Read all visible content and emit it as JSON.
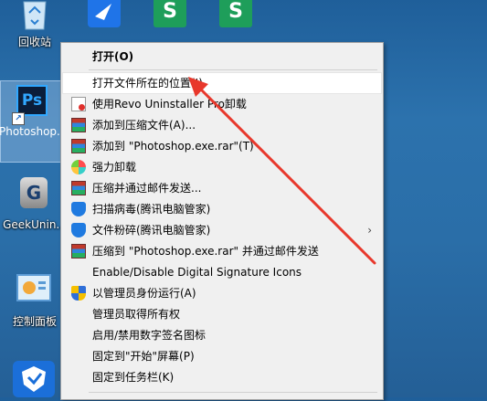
{
  "desktop": {
    "icons": {
      "recycle_bin": "回收站",
      "photoshop": "Photoshop.exe",
      "geek": "GeekUnin...",
      "control_panel": "控制面板"
    },
    "top_app_1": "S",
    "top_app_2": "S"
  },
  "menu": {
    "items": [
      {
        "label": "打开(O)"
      },
      {
        "label": "打开文件所在的位置(I)"
      },
      {
        "label": "使用Revo Uninstaller Pro卸载"
      },
      {
        "label": "添加到压缩文件(A)..."
      },
      {
        "label": "添加到 \"Photoshop.exe.rar\"(T)"
      },
      {
        "label": "强力卸载"
      },
      {
        "label": "压缩并通过邮件发送..."
      },
      {
        "label": "扫描病毒(腾讯电脑管家)"
      },
      {
        "label": "文件粉碎(腾讯电脑管家)"
      },
      {
        "label": "压缩到 \"Photoshop.exe.rar\" 并通过邮件发送"
      },
      {
        "label": "Enable/Disable Digital Signature Icons"
      },
      {
        "label": "以管理员身份运行(A)"
      },
      {
        "label": "管理员取得所有权"
      },
      {
        "label": "启用/禁用数字签名图标"
      },
      {
        "label": "固定到\"开始\"屏幕(P)"
      },
      {
        "label": "固定到任务栏(K)"
      }
    ],
    "submenu_arrow": "›"
  },
  "colors": {
    "annotation": "#e8382c",
    "menu_bg": "#f0f0f0",
    "highlight": "#ffffff"
  }
}
